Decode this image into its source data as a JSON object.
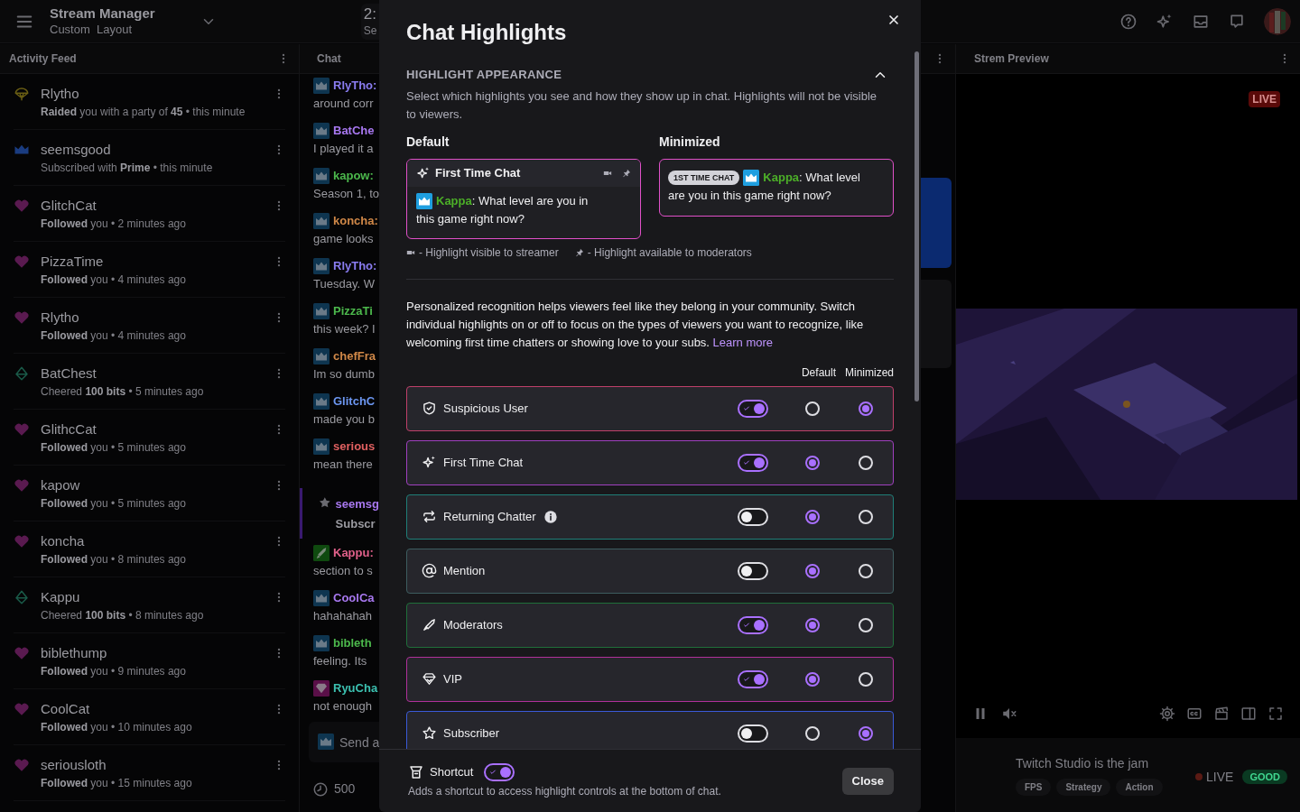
{
  "top_bar": {
    "title": "Stream Manager",
    "subtitle": "Custom  Layout",
    "widget": {
      "line_1": "2:",
      "line_2": "Se"
    }
  },
  "activity_feed": {
    "title": "Activity Feed",
    "items": [
      {
        "kind": "raid",
        "name": "Rlytho",
        "detail": "**Raided** you with a party of **45** • this minute"
      },
      {
        "kind": "prime",
        "name": "seemsgood",
        "detail": "Subscribed with **Prime** • this minute"
      },
      {
        "kind": "follow",
        "name": "GlitchCat",
        "detail": "**Followed** you • 2 minutes ago"
      },
      {
        "kind": "follow",
        "name": "PizzaTime",
        "detail": "**Followed** you • 4 minutes ago"
      },
      {
        "kind": "follow",
        "name": "Rlytho",
        "detail": "**Followed** you • 4 minutes ago"
      },
      {
        "kind": "cheer",
        "name": "BatChest",
        "detail": "Cheered **100 bits** • 5 minutes ago"
      },
      {
        "kind": "follow",
        "name": "GlithcCat",
        "detail": "**Followed** you • 5 minutes ago"
      },
      {
        "kind": "follow",
        "name": "kapow",
        "detail": "**Followed** you • 5 minutes ago"
      },
      {
        "kind": "follow",
        "name": "koncha",
        "detail": "**Followed** you • 8 minutes ago"
      },
      {
        "kind": "cheer",
        "name": "Kappu",
        "detail": "Cheered **100 bits** • 8 minutes ago"
      },
      {
        "kind": "follow",
        "name": "biblethump",
        "detail": "**Followed** you • 9 minutes ago"
      },
      {
        "kind": "follow",
        "name": "CoolCat",
        "detail": "**Followed** you • 10 minutes ago"
      },
      {
        "kind": "follow",
        "name": "seriousloth",
        "detail": "**Followed** you • 15 minutes ago"
      }
    ]
  },
  "chat": {
    "title": "Chat",
    "messages": [
      {
        "kind": "subscriber",
        "name": "RlyTho:",
        "color": "#8a7cf0",
        "text": "around corr"
      },
      {
        "kind": "subscriber",
        "name": "BatChe",
        "color": "#a878f0",
        "text": "I played it a"
      },
      {
        "kind": "subscriber",
        "name": "kapow:",
        "color": "#4cb84c",
        "text": "Season 1, to"
      },
      {
        "kind": "subscriber",
        "name": "koncha:",
        "color": "#d08848",
        "text": "game looks"
      },
      {
        "kind": "subscriber",
        "name": "RlyTho:",
        "color": "#8a7cf0",
        "text": "Tuesday. W"
      },
      {
        "kind": "subscriber",
        "name": "PizzaTi",
        "color": "#4cb84c",
        "text": "this week? I"
      },
      {
        "kind": "subscriber",
        "name": "chefFra",
        "color": "#d08848",
        "text": "Im so dumb"
      },
      {
        "kind": "subscriber",
        "name": "GlitchC",
        "color": "#6c96f0",
        "text": "made you b"
      },
      {
        "kind": "subscriber",
        "name": "serious",
        "color": "#e06060",
        "text": "mean there"
      },
      {
        "kind": "subscription",
        "name": "seemsg",
        "color": "#a878f0",
        "text": "Subscr"
      },
      {
        "kind": "moderator",
        "name": "Kappu:",
        "color": "#e0608a",
        "text": "section to s"
      },
      {
        "kind": "subscriber",
        "name": "CoolCa",
        "color": "#a878f0",
        "text": "hahahahah"
      },
      {
        "kind": "subscriber",
        "name": "bibleth",
        "color": "#4cb84c",
        "text": "feeling. Its"
      },
      {
        "kind": "vip",
        "name": "RyuCha",
        "color": "#3cc0b0",
        "text": "not enough"
      }
    ],
    "placeholder": "Send a",
    "points": "500"
  },
  "stream_preview": {
    "title": "Strem Preview",
    "live_badge": "LIVE",
    "stream_title": "Twitch Studio is the jam",
    "tags": [
      "FPS",
      "Strategy",
      "Action"
    ],
    "status": "LIVE",
    "health": "GOOD"
  },
  "dialog": {
    "title": "Chat Highlights",
    "section": {
      "heading": "HIGHLIGHT APPEARANCE",
      "expanded": true,
      "description": "Select which highlights you see and how they show up in chat. Highlights will not be visible to viewers.",
      "default_preview": {
        "label": "Default",
        "header": "First Time Chat",
        "user": "Kappa",
        "message_lines": [
          ": What level are you in",
          "this game right now?"
        ]
      },
      "minimized_preview": {
        "label": "Minimized",
        "tag": "1ST TIME CHAT",
        "user": "Kappa",
        "message_lines": [
          ": What level",
          "are you in this game right now?"
        ]
      },
      "legend": [
        "- Highlight visible to streamer",
        "- Highlight available to moderators"
      ]
    },
    "intro": {
      "text": "Personalized recognition helps viewers feel like they belong in your community. Switch individual highlights on or off to focus on the types of viewers you want to recognize, like welcoming first time chatters or showing love to your subs.",
      "link": "Learn more"
    },
    "column_headers": [
      "Default",
      "Minimized"
    ],
    "rows": [
      {
        "label": "Suspicious User",
        "color": "#c0406a",
        "info": false,
        "on": true,
        "default": {
          "selected": false
        },
        "minimized": {
          "selected": true
        }
      },
      {
        "label": "First Time Chat",
        "color": "#a040c0",
        "info": false,
        "on": true,
        "default": {
          "selected": true
        },
        "minimized": {
          "selected": false
        }
      },
      {
        "label": "Returning Chatter",
        "color": "#1f7f78",
        "info": true,
        "on": false,
        "default": {
          "selected": true
        },
        "minimized": {
          "selected": false
        }
      },
      {
        "label": "Mention",
        "color": "#3d5d60",
        "info": false,
        "on": false,
        "default": {
          "selected": true
        },
        "minimized": {
          "selected": false
        }
      },
      {
        "label": "Moderators",
        "color": "#1f6f3a",
        "info": false,
        "on": true,
        "default": {
          "selected": true
        },
        "minimized": {
          "selected": false
        }
      },
      {
        "label": "VIP",
        "color": "#b0309a",
        "info": false,
        "on": true,
        "default": {
          "selected": true
        },
        "minimized": {
          "selected": false
        }
      },
      {
        "label": "Subscriber",
        "color": "#3a5ad8",
        "info": false,
        "on": false,
        "default": {
          "selected": false
        },
        "minimized": {
          "selected": true
        }
      }
    ],
    "shortcut": {
      "label": "Shortcut",
      "on": true,
      "description": "Adds a shortcut to access highlight controls at the bottom of chat."
    },
    "close_button": "Close"
  }
}
